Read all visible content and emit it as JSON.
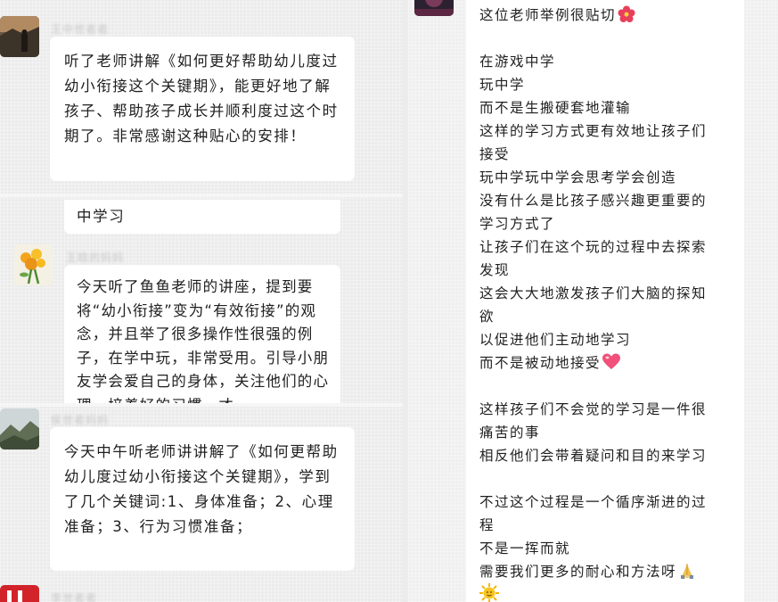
{
  "left_chat": {
    "messages": [
      {
        "name": "王中世者者",
        "text": "听了老师讲解《如何更好帮助幼儿度过幼小衔接这个关键期》，能更好地了解孩子、帮助孩子成长并顺利度过这个时期了。非常感谢这种贴心的安排！"
      },
      {
        "fragment": "中学习"
      },
      {
        "name": "王晗的妈妈",
        "text": "今天听了鱼鱼老师的讲座，提到要将“幼小衔接”变为“有效衔接”的观念，并且举了很多操作性很强的例子，在学中玩，非常受用。引导小朋友学会爱自己的身体，关注他们的心理，培养好的习惯，才"
      },
      {
        "name": "侯世者妈妈",
        "text": "今天中午听老师讲讲解了《如何更帮助幼儿度过幼小衔接这个关键期》，学到了几个关键词:1、身体准备；2、心理准备；3、行为习惯准备；"
      },
      {
        "name": "李世者者"
      }
    ]
  },
  "right_chat": {
    "lines": [
      "这位老师举例很贴切🌺",
      "",
      "在游戏中学",
      "玩中学",
      "而不是生搬硬套地灌输",
      "这样的学习方式更有效地让孩子们",
      "接受",
      "玩中学玩中学会思考学会创造",
      "没有什么是比孩子感兴趣更重要的",
      "学习方式了",
      "让孩子们在这个玩的过程中去探索",
      "发现",
      "这会大大地激发孩子们大脑的探知",
      "欲",
      "以促进他们主动地学习",
      "而不是被动地接受💗",
      "",
      "这样孩子们不会觉的学习是一件很",
      "痛苦的事",
      "相反他们会带着疑问和目的来学习",
      "",
      "不过这个过程是一个循序渐进的过",
      "程",
      "不是一挥而就",
      "需要我们更多的耐心和方法呀🙏",
      "🌞"
    ]
  },
  "colors": {
    "background": "#ebebeb",
    "bubble": "#ffffff",
    "text": "#202020",
    "name": "#c9c9c9",
    "hibiscus": "#e8405c",
    "heart": "#f0507a",
    "sun": "#f5b50a",
    "hands": "#f2c14e"
  },
  "icons": [
    "hibiscus-emoji",
    "pink-heart-emoji",
    "folded-hands-emoji",
    "sun-with-face-emoji"
  ]
}
